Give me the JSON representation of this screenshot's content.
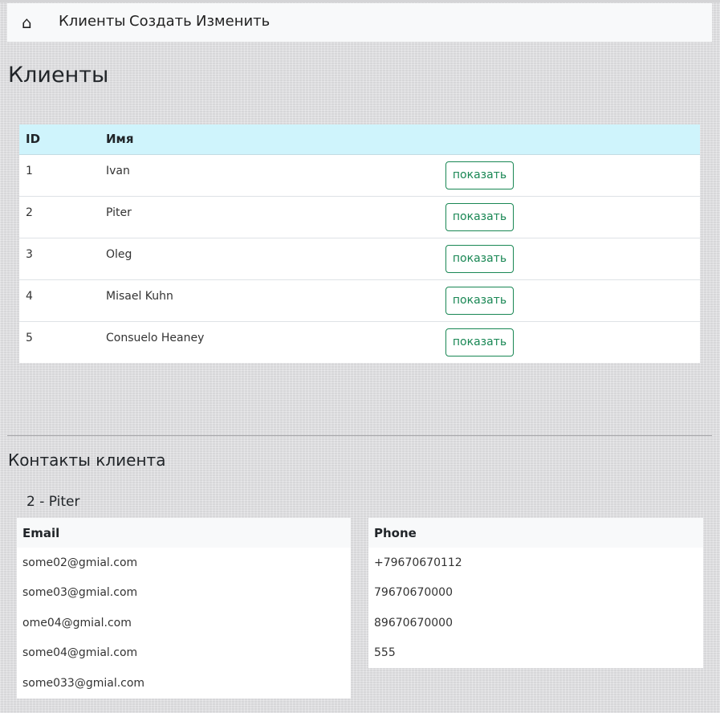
{
  "nav": {
    "home_icon": "⌂",
    "links": [
      "Клиенты",
      "Создать",
      "Изменить"
    ]
  },
  "page_title": "Клиенты",
  "clients_table": {
    "headers": [
      "ID",
      "Имя",
      ""
    ],
    "rows": [
      {
        "id": "1",
        "name": "Ivan",
        "action": "показать"
      },
      {
        "id": "2",
        "name": "Piter",
        "action": "показать"
      },
      {
        "id": "3",
        "name": "Oleg",
        "action": "показать"
      },
      {
        "id": "4",
        "name": "Misael Kuhn",
        "action": "показать"
      },
      {
        "id": "5",
        "name": "Consuelo Heaney",
        "action": "показать"
      }
    ]
  },
  "contacts": {
    "heading": "Контакты клиента",
    "client_label": "2 - Piter",
    "email_header": "Email",
    "emails": [
      "some02@gmial.com",
      "some03@gmial.com",
      "ome04@gmial.com",
      "some04@gmial.com",
      "some033@gmial.com"
    ],
    "phone_header": "Phone",
    "phones": [
      "+79670670112",
      "79670670000",
      "89670670000",
      "555"
    ]
  },
  "colors": {
    "header_row": "#cff4fc",
    "button_accent": "#198754",
    "navbar_bg": "#f8f9fa"
  }
}
